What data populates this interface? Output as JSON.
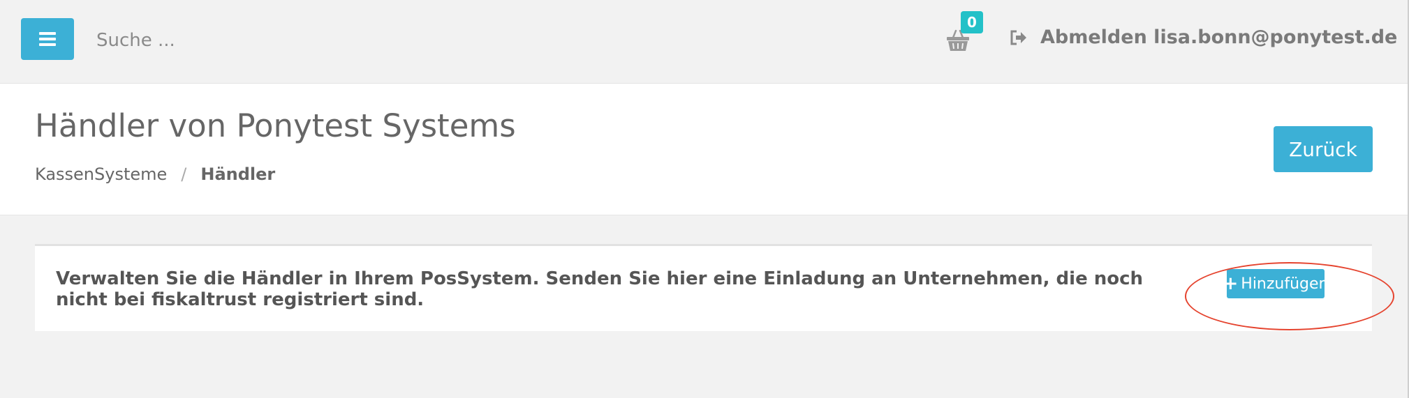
{
  "topbar": {
    "search_placeholder": "Suche ...",
    "cart_count": "0",
    "logout_label": "Abmelden lisa.bonn@ponytest.de"
  },
  "header": {
    "title": "Händler von Ponytest Systems",
    "breadcrumb": [
      "KassenSysteme",
      "Händler"
    ],
    "back_label": "Zurück"
  },
  "panel": {
    "description": "Verwalten Sie die Händler in Ihrem PosSystem. Senden Sie hier eine Einladung an Unternehmen, die noch nicht bei fiskaltrust registriert sind.",
    "add_label": "Hinzufügen"
  },
  "colors": {
    "accent": "#3cb0d6",
    "badge": "#23c1c8",
    "highlight": "#e5432e"
  }
}
